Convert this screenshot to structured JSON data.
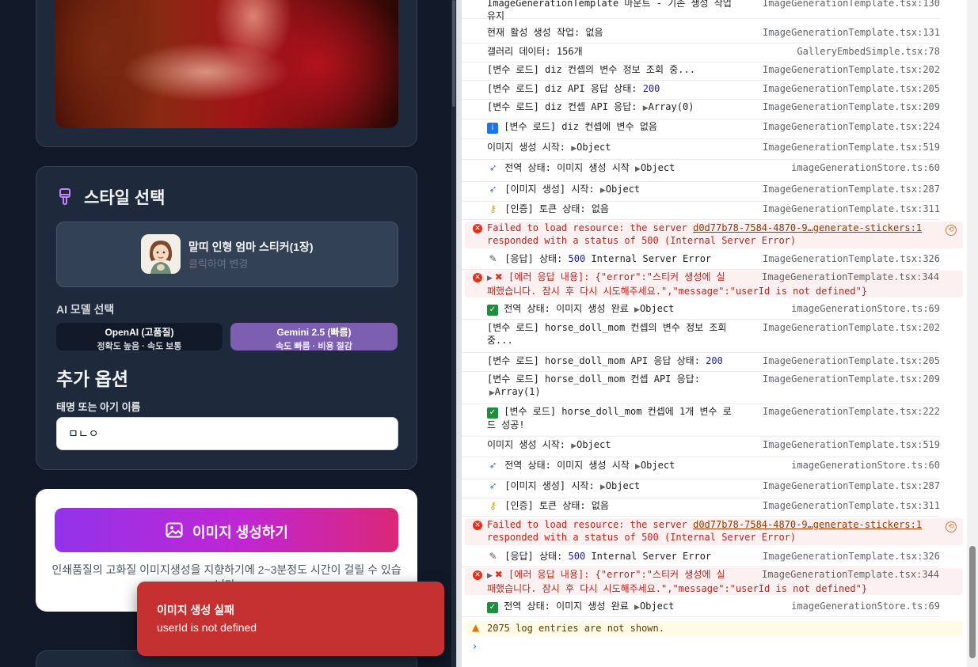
{
  "app": {
    "style_section": {
      "title": "스타일 선택",
      "selected_style_name": "말띠 인형 엄마 스티커(1장)",
      "selected_style_hint": "클릭하여 변경"
    },
    "model_section": {
      "label": "AI 모델 선택",
      "options": [
        {
          "name": "OpenAI (고품질)",
          "desc": "정확도 높음 · 속도 보통",
          "selected": false
        },
        {
          "name": "Gemini 2.5 (빠름)",
          "desc": "속도 빠름 · 비용 절감",
          "selected": true
        }
      ]
    },
    "extra_options": {
      "title": "추가 옵션",
      "name_label": "태명 또는 아기 이름",
      "name_value": "ㅁㄴㅇ"
    },
    "generate": {
      "button_label": "이미지 생성하기",
      "note": "인쇄품질의 고화질 이미지생성을 지향하기에 2~3분정도 시간이 걸릴 수 있습니다."
    },
    "toast": {
      "title": "이미지 생성 실패",
      "message": "userId is not defined"
    }
  },
  "console": {
    "logs": [
      {
        "msg": "ImageGenerationTemplate 마운트 - 기존 생성 작업",
        "msg2": "유지",
        "src": "ImageGenerationTemplate.tsx:130"
      },
      {
        "msg": "현재 활성 생성 작업: 없음",
        "src": "ImageGenerationTemplate.tsx:131"
      },
      {
        "msg": "갤러리 데이터: 156개",
        "src": "GalleryEmbedSimple.tsx:78"
      },
      {
        "msg": "[변수 로드] diz 컨셉의 변수 정보 조회 중...",
        "src": "ImageGenerationTemplate.tsx:202"
      },
      {
        "msg": "[변수 로드] diz API 응답 상태: ",
        "num": "200",
        "src": "ImageGenerationTemplate.tsx:205"
      },
      {
        "msg": "[변수 로드] diz 컨셉 API 응답: ",
        "obj": "Array(0)",
        "src": "ImageGenerationTemplate.tsx:209"
      },
      {
        "icon": "info",
        "msg": "[변수 로드] diz 컨셉에 변수 없음",
        "src": "ImageGenerationTemplate.tsx:224"
      },
      {
        "msg": "이미지 생성 시작: ",
        "obj": "Object",
        "src": "ImageGenerationTemplate.tsx:519"
      },
      {
        "icon": "rocket",
        "msg": "전역 상태: 이미지 생성 시작 ",
        "obj": "Object",
        "src": "imageGenerationStore.ts:60"
      },
      {
        "icon": "rocket",
        "msg": "[이미지 생성] 시작: ",
        "obj": "Object",
        "src": "ImageGenerationTemplate.tsx:287"
      },
      {
        "icon": "key",
        "msg": "[인증] 토큰 상태: 없음",
        "src": "ImageGenerationTemplate.tsx:311"
      },
      {
        "type": "error",
        "msg": "Failed to load resource: the server ",
        "link": "d0d77b78-7584-4870-9…generate-stickers:1",
        "msg2": "responded with a status of 500 (Internal Server Error)"
      },
      {
        "icon": "memo",
        "msg": "[응답] 상태: ",
        "num": "500",
        "msg_after": " Internal Server Error",
        "src": "ImageGenerationTemplate.tsx:326"
      },
      {
        "type": "error",
        "msg": "[에러 응답 내용]: {\"error\":\"스티커 생성에 실",
        "msg2": "패했습니다. 잠시 후 다시 시도해주세요.\",\"message\":\"userId is not defined\"}",
        "src": "ImageGenerationTemplate.tsx:344"
      },
      {
        "icon": "check",
        "msg": "전역 상태: 이미지 생성 완료 ",
        "obj": "Object",
        "src": "imageGenerationStore.ts:69"
      },
      {
        "msg": "[변수 로드] horse_doll_mom 컨셉의 변수 정보 조회",
        "msg2": "중...",
        "src": "ImageGenerationTemplate.tsx:202"
      },
      {
        "msg": "[변수 로드] horse_doll_mom API 응답 상태: ",
        "num": "200",
        "src": "ImageGenerationTemplate.tsx:205"
      },
      {
        "msg": "[변수 로드] horse_doll_mom 컨셉 API 응답:",
        "obj2": "Array(1)",
        "src": "ImageGenerationTemplate.tsx:209"
      },
      {
        "icon": "check",
        "msg": "[변수 로드] horse_doll_mom 컨셉에 1개 변수 로",
        "msg2": "드 성공!",
        "src": "ImageGenerationTemplate.tsx:222"
      },
      {
        "msg": "이미지 생성 시작: ",
        "obj": "Object",
        "src": "ImageGenerationTemplate.tsx:519"
      },
      {
        "icon": "rocket",
        "msg": "전역 상태: 이미지 생성 시작 ",
        "obj": "Object",
        "src": "imageGenerationStore.ts:60"
      },
      {
        "icon": "rocket",
        "msg": "[이미지 생성] 시작: ",
        "obj": "Object",
        "src": "ImageGenerationTemplate.tsx:287"
      },
      {
        "icon": "key",
        "msg": "[인증] 토큰 상태: 없음",
        "src": "ImageGenerationTemplate.tsx:311"
      },
      {
        "type": "error",
        "msg": "Failed to load resource: the server ",
        "link": "d0d77b78-7584-4870-9…generate-stickers:1",
        "msg2": "responded with a status of 500 (Internal Server Error)"
      },
      {
        "icon": "memo",
        "msg": "[응답] 상태: ",
        "num": "500",
        "msg_after": " Internal Server Error",
        "src": "ImageGenerationTemplate.tsx:326"
      },
      {
        "type": "error",
        "msg": "[에러 응답 내용]: {\"error\":\"스티커 생성에 실",
        "msg2": "패했습니다. 잠시 후 다시 시도해주세요.\",\"message\":\"userId is not defined\"}",
        "src": "ImageGenerationTemplate.tsx:344"
      },
      {
        "icon": "check",
        "msg": "전역 상태: 이미지 생성 완료 ",
        "obj": "Object",
        "src": "imageGenerationStore.ts:69"
      }
    ],
    "hidden_notice": "2075 log entries are not shown."
  },
  "colors": {
    "app_bg": "#111827",
    "card_bg": "#1e293b",
    "accent_purple": "#9333ea",
    "accent_pink": "#db2777",
    "toast_red": "#c53030",
    "console_error": "#b3261e"
  }
}
